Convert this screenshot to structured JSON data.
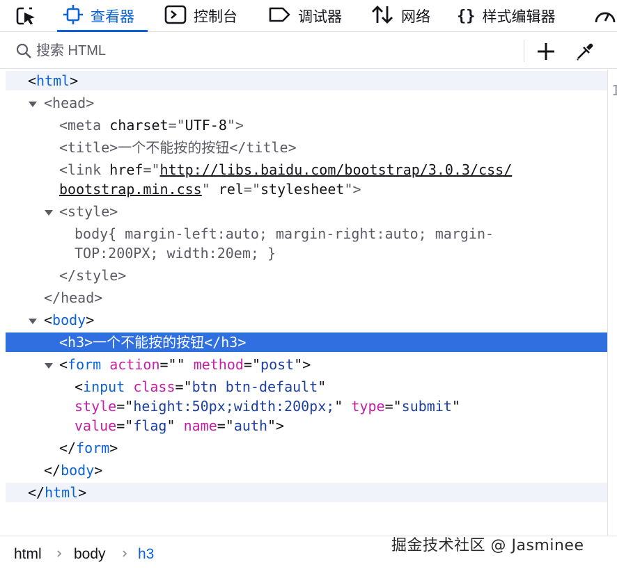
{
  "toolbar": {
    "pick_element": "pick-element-icon",
    "tabs": [
      {
        "label": "查看器",
        "icon": "inspector-icon",
        "active": true
      },
      {
        "label": "控制台",
        "icon": "console-icon",
        "active": false
      },
      {
        "label": "调试器",
        "icon": "debugger-icon",
        "active": false
      },
      {
        "label": "网络",
        "icon": "network-icon",
        "active": false
      },
      {
        "label": "样式编辑器",
        "icon": "style-editor-icon",
        "active": false
      }
    ],
    "overflow_icon": "performance-icon"
  },
  "search": {
    "placeholder": "搜索 HTML"
  },
  "tree": {
    "r0": {
      "open": "<",
      "tag": "html",
      "close": ">"
    },
    "r1": {
      "open": "<",
      "tag": "head",
      "close": ">"
    },
    "r2": {
      "open": "<",
      "tag": "meta",
      "sp": " ",
      "attr": "charset",
      "eq": "=\"",
      "val": "UTF-8",
      "close": "\">"
    },
    "r3": {
      "text": "<title>一个不能按的按钮</title>"
    },
    "r4": {
      "open": "<",
      "tag": "link",
      "sp": " ",
      "attr": "href",
      "eq": "=\"",
      "val1": "http://libs.baidu.com/bootstrap/3.0.3/css/",
      "val2": "bootstrap.min.css",
      "q": "\"",
      "sp2": " ",
      "attr2": "rel",
      "eq2": "=\"",
      "val3": "stylesheet",
      "close": "\">"
    },
    "r5": {
      "open": "<",
      "tag": "style",
      "close": ">"
    },
    "r6": {
      "line1": "body{ margin-left:auto; margin-right:auto; margin-",
      "line2": "TOP:200PX; width:20em; }"
    },
    "r7": {
      "text": "</style>"
    },
    "r8": {
      "text": "</head>"
    },
    "r9": {
      "open": "<",
      "tag": "body",
      "close": ">"
    },
    "r10": {
      "text": "<h3>一个不能按的按钮</h3>"
    },
    "r11": {
      "open": "<",
      "tag": "form",
      "sp": " ",
      "attr": "action",
      "eq": "=\"\"",
      "sp2": " ",
      "attr2": "method",
      "eq2": "=\"",
      "val2": "post",
      "close": "\">"
    },
    "r12": {
      "open": "<",
      "tag": "input",
      "sp": " ",
      "attr": "class",
      "eq": "=\"",
      "val": "btn btn-default",
      "q": "\""
    },
    "r13": {
      "attr": "style",
      "eq": "=\"",
      "val": "height:50px;width:200px;",
      "q": "\"",
      "sp": " ",
      "attr2": "type",
      "eq2": "=\"",
      "val2": "submit",
      "q2": "\""
    },
    "r14": {
      "attr": "value",
      "eq": "=\"",
      "val": "flag",
      "q": "\"",
      "sp": " ",
      "attr2": "name",
      "eq2": "=\"",
      "val2": "auth",
      "close": "\">"
    },
    "r15": {
      "open": "</",
      "tag": "form",
      "close": ">"
    },
    "r16": {
      "open": "</",
      "tag": "body",
      "close": ">"
    },
    "r17": {
      "open": "</",
      "tag": "html",
      "close": ">"
    }
  },
  "right_pane_mark": "1",
  "breadcrumb": [
    "html",
    "body",
    "h3"
  ],
  "watermark": "掘金技术社区 @ Jasminee",
  "colors": {
    "accent": "#0b63d6",
    "selection": "#2f6fe0",
    "attr_name": "#c420a5",
    "attr_value": "#1d3f9e"
  }
}
